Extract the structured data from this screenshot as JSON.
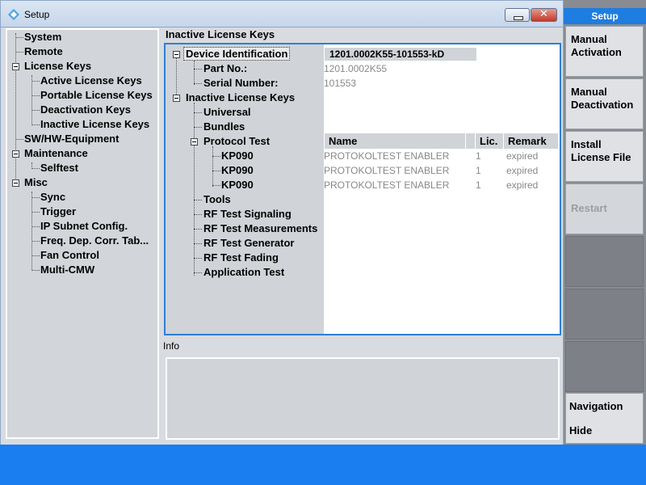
{
  "window": {
    "title": "Setup",
    "app_icon": "rohde-schwarz-icon"
  },
  "nav": {
    "items": [
      {
        "label": "System"
      },
      {
        "label": "Remote"
      },
      {
        "label": "License Keys"
      },
      {
        "label": "Active License Keys"
      },
      {
        "label": "Portable License Keys"
      },
      {
        "label": "Deactivation Keys"
      },
      {
        "label": "Inactive License Keys"
      },
      {
        "label": "SW/HW-Equipment"
      },
      {
        "label": "Maintenance"
      },
      {
        "label": "Selftest"
      },
      {
        "label": "Misc"
      },
      {
        "label": "Sync"
      },
      {
        "label": "Trigger"
      },
      {
        "label": "IP Subnet Config."
      },
      {
        "label": "Freq. Dep. Corr. Tab..."
      },
      {
        "label": "Fan Control"
      },
      {
        "label": "Multi-CMW"
      }
    ]
  },
  "main": {
    "title": "Inactive License Keys",
    "device_identification": {
      "label": "Device Identification",
      "value": "1201.0002K55-101553-kD",
      "part_no_label": "Part No.:",
      "part_no_value": "1201.0002K55",
      "serial_label": "Serial Number:",
      "serial_value": "101553"
    },
    "inactive_keys_label": "Inactive License Keys",
    "categories": {
      "universal": "Universal",
      "bundles": "Bundles",
      "protocol_test": "Protocol Test",
      "tools": "Tools",
      "rf_signaling": "RF Test Signaling",
      "rf_measurements": "RF Test Measurements",
      "rf_generator": "RF Test Generator",
      "rf_fading": "RF Test Fading",
      "application_test": "Application Test"
    },
    "columns": {
      "name": "Name",
      "lic": "Lic.",
      "remark": "Remark"
    },
    "rows": [
      {
        "key": "KP090",
        "name": "PROTOKOLTEST ENABLER",
        "lic": "1",
        "remark": "expired"
      },
      {
        "key": "KP090",
        "name": "PROTOKOLTEST ENABLER",
        "lic": "1",
        "remark": "expired"
      },
      {
        "key": "KP090",
        "name": "PROTOKOLTEST ENABLER",
        "lic": "1",
        "remark": "expired"
      }
    ],
    "info_label": "Info"
  },
  "softkeys": {
    "header": "Setup",
    "manual_activation": "Manual Activation",
    "manual_deactivation": "Manual Deactivation",
    "install_license_file": "Install License File",
    "restart": "Restart",
    "navigation": "Navigation",
    "hide": "Hide"
  },
  "colors": {
    "accent": "#1e7de0",
    "bottom_bar": "#1a7df0",
    "selection_border": "#2e7fd4"
  }
}
